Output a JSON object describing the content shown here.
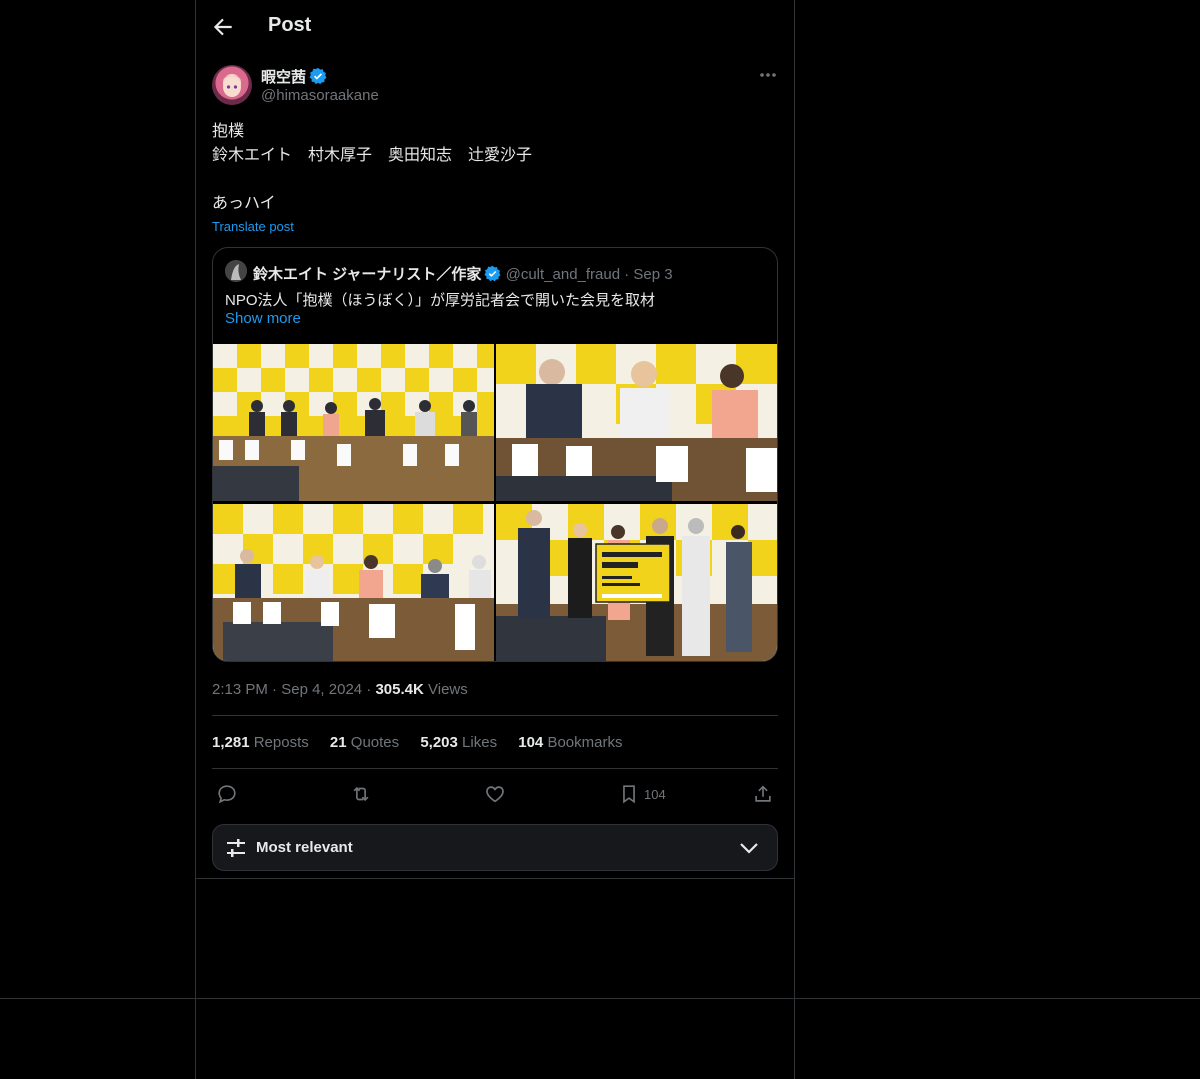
{
  "header": {
    "title": "Post"
  },
  "post": {
    "author_name": "暇空茜",
    "author_handle": "@himasoraakane",
    "text_lines": [
      "抱樸",
      "鈴木エイト　村木厚子　奥田知志　辻愛沙子",
      "",
      "あっハイ"
    ],
    "translate_label": "Translate post",
    "time": "2:13 PM",
    "date": "Sep 4, 2024",
    "views_count": "305.4K",
    "views_label": "Views"
  },
  "quote": {
    "author_name": "鈴木エイト ジャーナリスト／作家",
    "author_handle": "@cult_and_fraud",
    "date": "Sep 3",
    "text": "NPO法人「抱樸（ほうぼく）」が厚労記者会で開いた会見を取材",
    "show_more": "Show more"
  },
  "stats": [
    {
      "count": "1,281",
      "label": "Reposts"
    },
    {
      "count": "21",
      "label": "Quotes"
    },
    {
      "count": "5,203",
      "label": "Likes"
    },
    {
      "count": "104",
      "label": "Bookmarks"
    }
  ],
  "actions": {
    "bookmark_count": "104"
  },
  "sort": {
    "label": "Most relevant"
  },
  "colors": {
    "accent": "#1d9bf0",
    "background": "#000000",
    "border": "#2f3336",
    "muted": "#71767b",
    "banner_yellow": "#f2d31b"
  },
  "icons": [
    "back-arrow-icon",
    "verified-badge-icon",
    "more-icon",
    "reply-icon",
    "repost-icon",
    "like-icon",
    "bookmark-icon",
    "share-icon",
    "sliders-icon",
    "chevron-down-icon"
  ]
}
